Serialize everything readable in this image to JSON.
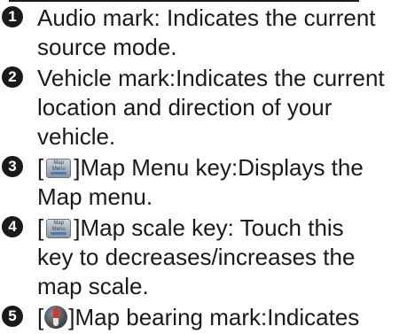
{
  "items": [
    {
      "number": "1",
      "lines": [
        "Audio mark: Indicates the current",
        "source mode."
      ]
    },
    {
      "number": "2",
      "lines": [
        "Vehicle mark:Indicates the current",
        "location and direction of your",
        "vehicle."
      ]
    },
    {
      "number": "3",
      "open_bracket": "[",
      "icon": "map-menu-key-icon",
      "line1_rest": "]Map Menu key:Displays the",
      "lines_after": [
        "Map menu."
      ]
    },
    {
      "number": "4",
      "open_bracket": "[",
      "icon": "map-scale-key-icon",
      "line1_rest": "]Map scale key: Touch this",
      "lines_after": [
        "key to decreases/increases the",
        "map scale."
      ]
    },
    {
      "number": "5",
      "open_bracket": "[",
      "icon": "map-bearing-icon",
      "line1_rest": "]Map bearing mark:Indicates"
    }
  ],
  "key_icon_text": [
    "Map",
    "Menu"
  ],
  "colors": {
    "text": "#1a1a1a",
    "badge_bg": "#1a1a1a",
    "badge_text": "#ffffff"
  }
}
